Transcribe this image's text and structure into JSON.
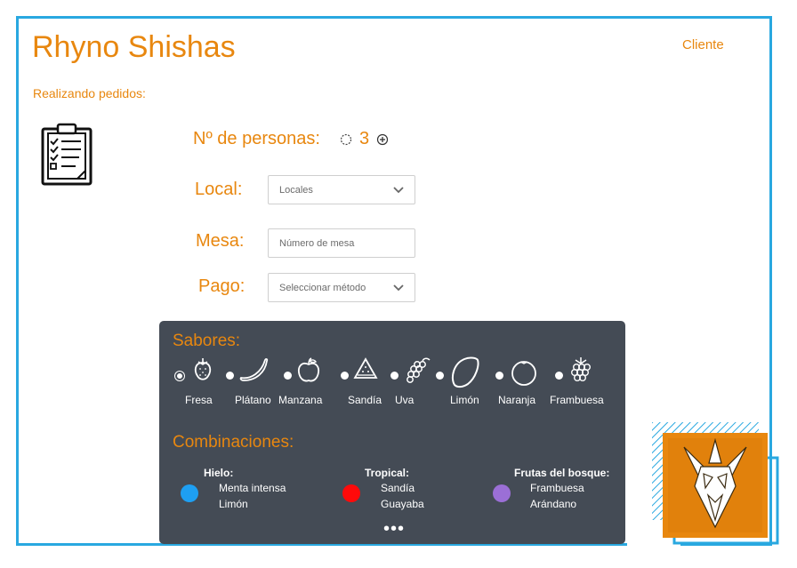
{
  "header": {
    "brand": "Rhyno Shishas",
    "client_link": "Cliente"
  },
  "subtitle": "Realizando pedidos:",
  "form": {
    "persons_label": "Nº de personas:",
    "persons_value": "3",
    "local_label": "Local:",
    "local_value": "Locales",
    "mesa_label": "Mesa:",
    "mesa_placeholder": "Número de mesa",
    "pago_label": "Pago:",
    "pago_value": "Seleccionar método"
  },
  "flavors": {
    "title": "Sabores:",
    "items": [
      {
        "label": "Fresa",
        "icon": "strawberry-icon",
        "selected": true
      },
      {
        "label": "Plátano",
        "icon": "banana-icon",
        "selected": false
      },
      {
        "label": "Manzana",
        "icon": "apple-icon",
        "selected": false
      },
      {
        "label": "Sandía",
        "icon": "watermelon-icon",
        "selected": false
      },
      {
        "label": "Uva",
        "icon": "grape-icon",
        "selected": false
      },
      {
        "label": "Limón",
        "icon": "lemon-icon",
        "selected": false
      },
      {
        "label": "Naranja",
        "icon": "orange-icon",
        "selected": false
      },
      {
        "label": "Frambuesa",
        "icon": "raspberry-icon",
        "selected": false
      }
    ]
  },
  "combinations": {
    "title": "Combinaciones:",
    "items": [
      {
        "name": "Hielo:",
        "line1": "Menta intensa",
        "line2": "Limón",
        "color": "#1e9ff2"
      },
      {
        "name": "Tropical:",
        "line1": "Sandía",
        "line2": "Guayaba",
        "color": "#ff0a0a"
      },
      {
        "name": "Frutas del bosque:",
        "line1": "Frambuesa",
        "line2": "Arándano",
        "color": "#9b6fd6"
      }
    ],
    "more": "•••"
  },
  "colors": {
    "accent": "#e8870f",
    "frame": "#29a8e0",
    "panel": "#444b55"
  }
}
